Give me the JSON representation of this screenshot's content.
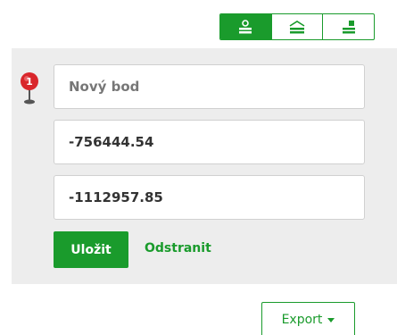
{
  "toolbar": {
    "modes": [
      {
        "icon": "point-tool-icon",
        "active": true
      },
      {
        "icon": "line-tool-icon",
        "active": false
      },
      {
        "icon": "polygon-tool-icon",
        "active": false
      }
    ]
  },
  "point": {
    "marker_number": "1",
    "name_placeholder": "Nový bod",
    "name_value": "",
    "x_value": "-756444.54",
    "y_value": "-1112957.85"
  },
  "actions": {
    "save_label": "Uložit",
    "remove_label": "Odstranit"
  },
  "export": {
    "label": "Export"
  },
  "colors": {
    "accent": "#1a9b2c",
    "panel_bg": "#ededed",
    "marker_red": "#d9262b"
  }
}
